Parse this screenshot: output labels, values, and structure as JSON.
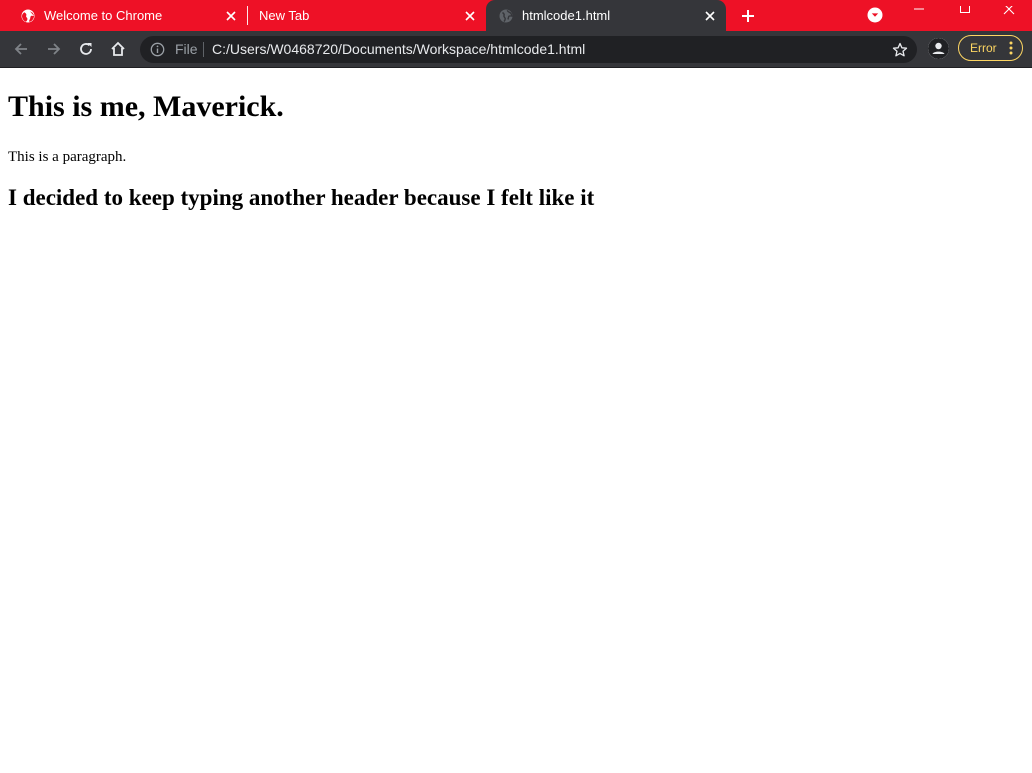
{
  "browser": {
    "tabs": [
      {
        "title": "Welcome to Chrome",
        "icon": "chrome-globe-icon",
        "active": false
      },
      {
        "title": "New Tab",
        "icon": "",
        "active": false
      },
      {
        "title": "htmlcode1.html",
        "icon": "globe-icon",
        "active": true
      }
    ],
    "omnibox": {
      "scheme_label": "File",
      "url": "C:/Users/W0468720/Documents/Workspace/htmlcode1.html"
    },
    "error_label": "Error",
    "colors": {
      "tabstrip": "#ee1126",
      "toolbar": "#35363a",
      "omnibox": "#202124",
      "error_accent": "#fdd663"
    }
  },
  "content": {
    "heading1": "This is me, Maverick.",
    "paragraph": "This is a paragraph.",
    "heading2": "I decided to keep typing another header because I felt like it"
  }
}
